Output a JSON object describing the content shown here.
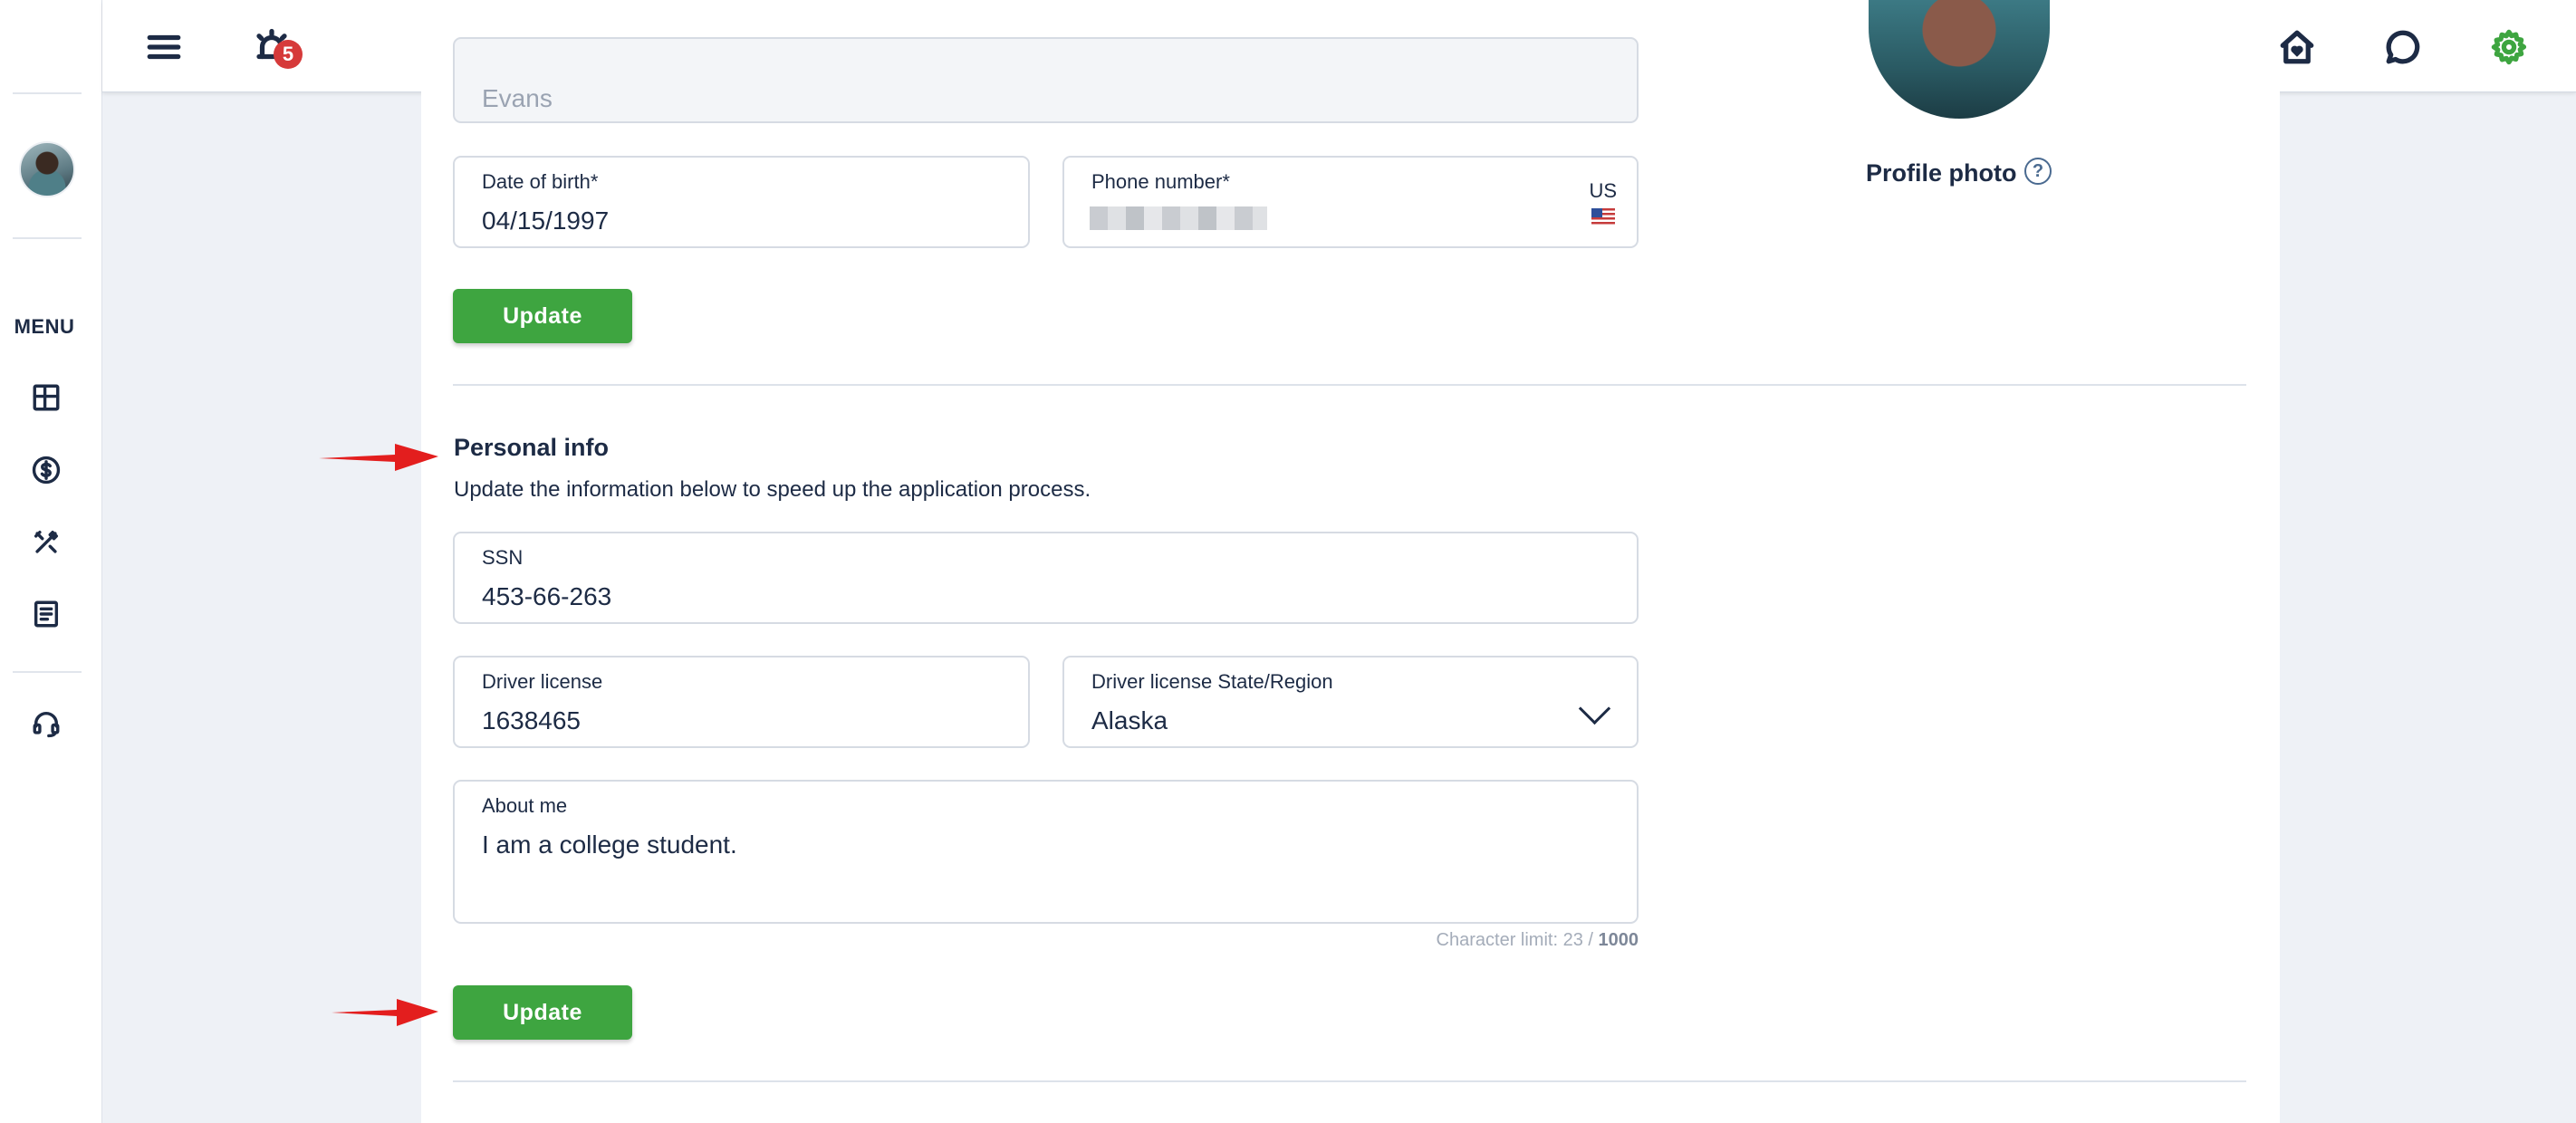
{
  "sidebar": {
    "menu_label": "MENU",
    "items": [
      {
        "icon": "dashboard-icon"
      },
      {
        "icon": "dollar-icon"
      },
      {
        "icon": "tools-icon"
      },
      {
        "icon": "document-icon"
      },
      {
        "icon": "headset-icon"
      }
    ]
  },
  "topbar": {
    "notifications_count": "5",
    "icons": [
      "hamburger-menu-icon",
      "alarm-bell-icon",
      "home-heart-icon",
      "chat-icon",
      "settings-gear-icon"
    ]
  },
  "colors": {
    "accent_green": "#3ea540",
    "text_dark": "#1d2b45",
    "badge_red": "#d63a3a",
    "arrow_red": "#e31e1e"
  },
  "profile": {
    "last_name_value": "Evans",
    "dob_label": "Date of birth*",
    "dob_value": "04/15/1997",
    "phone_label": "Phone number*",
    "phone_country": "US",
    "update_label": "Update",
    "photo_label": "Profile photo"
  },
  "personal_info": {
    "title": "Personal info",
    "description": "Update the information below to speed up the application process.",
    "ssn_label": "SSN",
    "ssn_value": "453-66-263",
    "license_label": "Driver license",
    "license_value": "1638465",
    "state_label": "Driver license State/Region",
    "state_value": "Alaska",
    "about_label": "About me",
    "about_value": "I am a college student.",
    "char_limit_prefix": "Character limit: 23 / ",
    "char_limit_max": "1000",
    "update_label": "Update"
  }
}
